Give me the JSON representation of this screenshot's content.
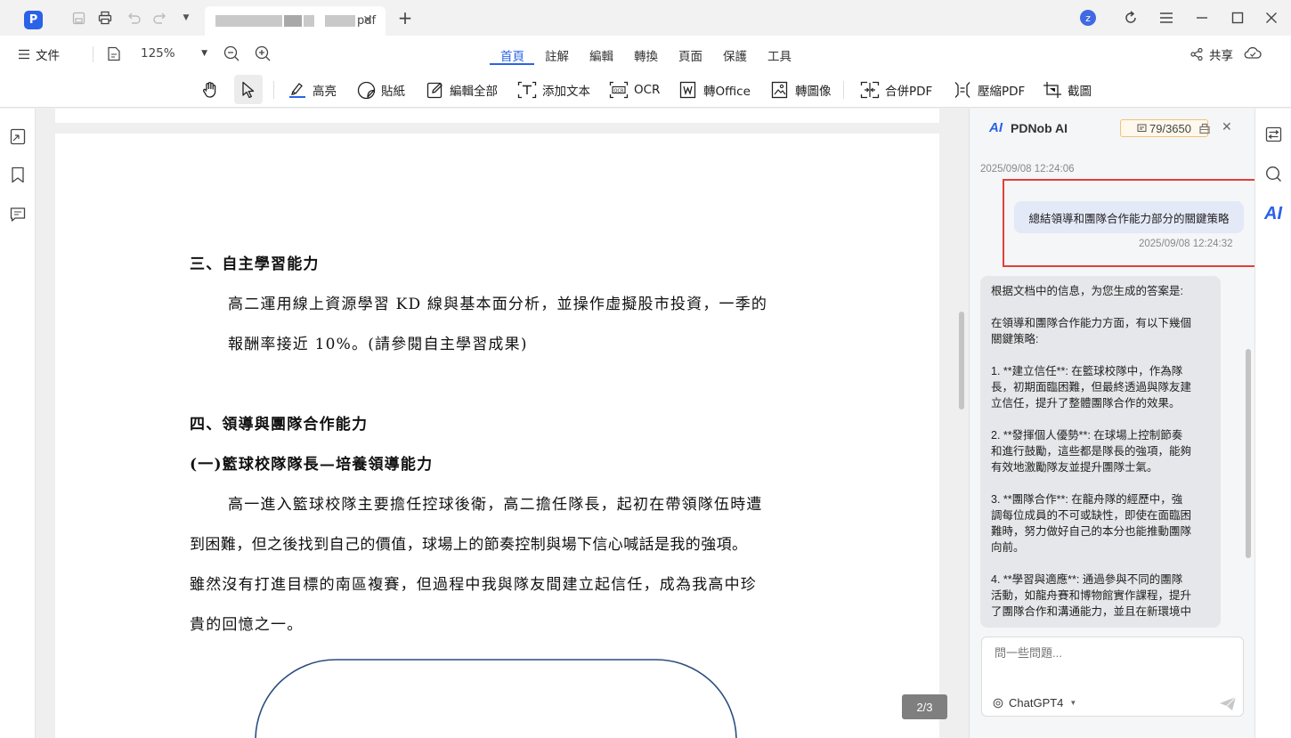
{
  "titlebar": {
    "doc_tab_suffix": "pdf",
    "user_initial": "z"
  },
  "menubar": {
    "file_label": "文件",
    "zoom": "125%",
    "tabs": [
      {
        "label": "首頁",
        "active": true
      },
      {
        "label": "註解"
      },
      {
        "label": "編輯"
      },
      {
        "label": "轉換"
      },
      {
        "label": "頁面"
      },
      {
        "label": "保護"
      },
      {
        "label": "工具"
      }
    ],
    "share_label": "共享"
  },
  "toolbar": {
    "highlight": "高亮",
    "sticker": "貼紙",
    "edit_all": "編輯全部",
    "add_text": "添加文本",
    "ocr": "OCR",
    "to_office": "轉Office",
    "to_image": "轉圖像",
    "merge_pdf": "合併PDF",
    "compress_pdf": "壓縮PDF",
    "screenshot": "截圖"
  },
  "document": {
    "section3_heading": "三、自主學習能力",
    "section3_line1": "高二運用線上資源學習 KD 線與基本面分析，並操作虛擬股市投資，一季的",
    "section3_line2": "報酬率接近 10%。(請參閱自主學習成果)",
    "section4_heading": "四、領導與團隊合作能力",
    "section4_sub": "(一)籃球校隊隊長—培養領導能力",
    "section4_line1": "高一進入籃球校隊主要擔任控球後衛，高二擔任隊長，起初在帶領隊伍時遭",
    "section4_line2": "到困難，但之後找到自己的價值，球場上的節奏控制與場下信心喊話是我的強項。",
    "section4_line3": "雖然沒有打進目標的南區複賽，但過程中我與隊友間建立起信任，成為我高中珍",
    "section4_line4": "貴的回憶之一。",
    "page_indicator": "2/3"
  },
  "ai_panel": {
    "title": "PDNob AI",
    "quota": "79/3650",
    "timestamp1": "2025/09/08 12:24:06",
    "user_message": "總結領導和團隊合作能力部分的關鍵策略",
    "timestamp2": "2025/09/08 12:24:32",
    "answer_paragraphs": [
      "根据文档中的信息，为您生成的答案是:",
      "在領導和團隊合作能力方面，有以下幾個\n關鍵策略:",
      "1. **建立信任**: 在籃球校隊中，作為隊\n長，初期面臨困難，但最終透過與隊友建\n立信任，提升了整體團隊合作的效果。",
      "2. **發揮個人優勢**: 在球場上控制節奏\n和進行鼓勵，這些都是隊長的強項，能夠\n有效地激勵隊友並提升團隊士氣。",
      "3. **團隊合作**: 在龍舟隊的經歷中，強\n調每位成員的不可或缺性，即使在面臨困\n難時，努力做好自己的本分也能推動團隊\n向前。",
      "4. **學習與適應**: 通過參與不同的團隊\n活動，如龍舟賽和博物館實作課程，提升\n了團隊合作和溝通能力，並且在新環境中"
    ],
    "input_placeholder": "問一些問題...",
    "model": "ChatGPT4"
  },
  "colors": {
    "accent": "#2a62e8",
    "highlight_box": "#e0403a"
  }
}
